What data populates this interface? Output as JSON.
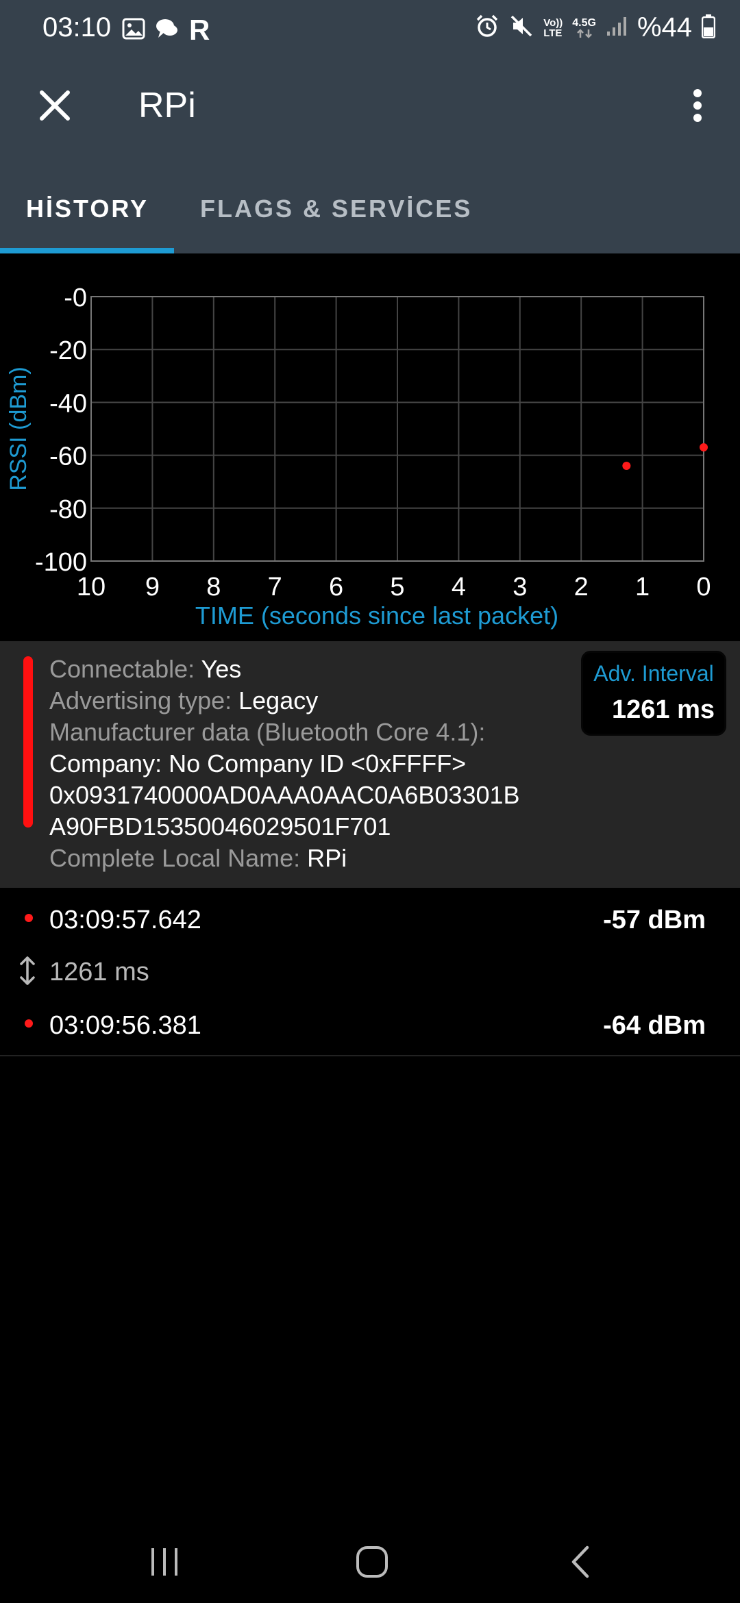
{
  "status_bar": {
    "time": "03:10",
    "battery_text": "%44",
    "icons": [
      "image-icon",
      "chat-icon",
      "r-app-icon",
      "alarm-icon",
      "mute-icon",
      "volte-icon",
      "4-5g-icon",
      "signal-icon",
      "battery-icon"
    ],
    "r_letter": "R",
    "volte_top": "Vo))",
    "volte_bottom": "LTE",
    "net_label": "4.5G"
  },
  "app_bar": {
    "title": "RPi"
  },
  "tabs": [
    {
      "label": "HİSTORY",
      "active": true
    },
    {
      "label": "FLAGS & SERVİCES",
      "active": false
    }
  ],
  "chart_data": {
    "type": "scatter",
    "xlabel": "TIME (seconds since last packet)",
    "ylabel": "RSSI (dBm)",
    "xlim": [
      10,
      0
    ],
    "ylim": [
      -100,
      0
    ],
    "x_ticks": [
      "10",
      "9",
      "8",
      "7",
      "6",
      "5",
      "4",
      "3",
      "2",
      "1",
      "0"
    ],
    "y_ticks": [
      "-0",
      "-20",
      "-40",
      "-60",
      "-80",
      "-100"
    ],
    "grid": true,
    "points": [
      {
        "x": 0.0,
        "y": -57
      },
      {
        "x": 1.26,
        "y": -64
      }
    ],
    "colors": {
      "point": "#ff1a1a",
      "axis_label": "#1e9bd3",
      "grid": "#444444"
    }
  },
  "info": {
    "connectable_label": "Connectable: ",
    "connectable_value": "Yes",
    "adv_type_label": "Advertising type: ",
    "adv_type_value": "Legacy",
    "manufacturer_label": "Manufacturer data (Bluetooth Core 4.1):",
    "company_line": "Company: No Company ID <0xFFFF>",
    "data_line1": "0x0931740000AD0AAA0AAC0A6B03301B",
    "data_line2": "A90FBD15350046029501F701",
    "local_name_label": "Complete Local Name: ",
    "local_name_value": "RPi",
    "adv_interval_label": "Adv. Interval",
    "adv_interval_value": "1261 ms"
  },
  "packets": {
    "first": {
      "time": "03:09:57.642",
      "rssi": "-57 dBm"
    },
    "interval": "1261 ms",
    "second": {
      "time": "03:09:56.381",
      "rssi": "-64 dBm"
    }
  },
  "colors": {
    "header_bg": "#36414c",
    "accent": "#1e9bd3",
    "signal_red": "#ff1a1a"
  }
}
